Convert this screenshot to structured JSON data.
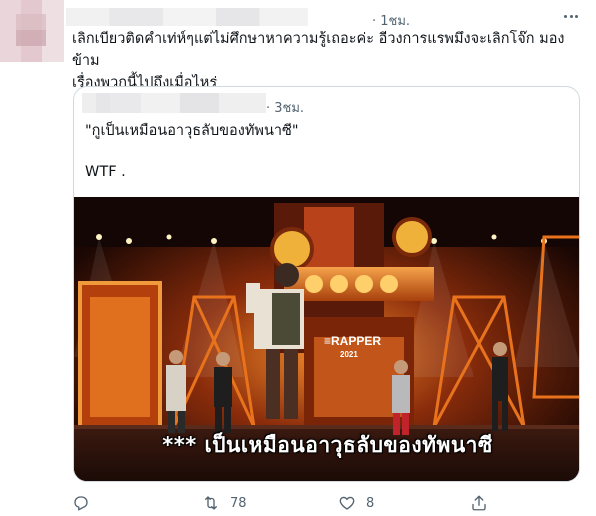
{
  "tweet": {
    "time": "· 1ชม.",
    "text": "เลิกเบียวติดคำเท่ห์ๆแต่ไม่ศึกษาหาความรู้เถอะค่ะ อีวงการแรพมึงจะเลิกโจ๊ก มองข้าม\nเรื่องพวกนี้ไปถึงเมื่อไหร่",
    "more_icon": "more-horizontal-icon"
  },
  "quote": {
    "time": "· 3ชม.",
    "line1": "\"กูเป็นเหมือนอาวุธลับของทัพนาซี\"",
    "line2": "WTF .",
    "media": {
      "subtitle": "*** เป็นเหมือนอาวุธลับของทัพนาซี",
      "stage_logo_line1": "≡RAPPER",
      "stage_logo_line2": "2021"
    }
  },
  "actions": {
    "reply_icon": "reply-icon",
    "retweet_icon": "retweet-icon",
    "retweet_count": "78",
    "like_icon": "heart-icon",
    "like_count": "8",
    "share_icon": "share-icon"
  },
  "colors": {
    "text": "#0f1419",
    "secondary": "#536471",
    "border": "#cfd9de",
    "stage_orange": "#e8731c",
    "stage_dark": "#2a0d05"
  }
}
